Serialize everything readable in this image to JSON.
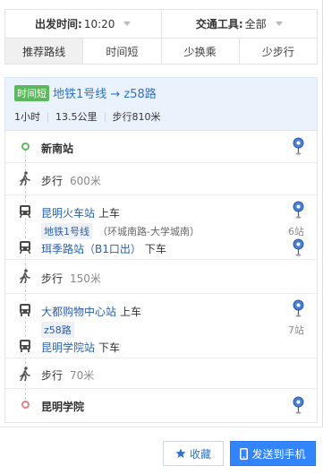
{
  "filters": {
    "depart_label": "出发时间:",
    "depart_value": "10:20",
    "transport_label": "交通工具:",
    "transport_value": "全部"
  },
  "tabs": [
    {
      "label": "推荐路线",
      "active": true
    },
    {
      "label": "时间短",
      "active": false
    },
    {
      "label": "少换乘",
      "active": false
    },
    {
      "label": "少步行",
      "active": false
    }
  ],
  "summary": {
    "tag": "时间短",
    "route": "地铁1号线 → z58路",
    "duration": "1小时",
    "distance": "13.5公里",
    "walk": "步行810米"
  },
  "steps": {
    "origin": "新南站",
    "walk1": {
      "label": "步行",
      "distance": "600米"
    },
    "ride1": {
      "board_station": "昆明火车站",
      "board_action": "上车",
      "line": "地铁1号线",
      "direction": "（环城南路-大学城南）",
      "stops": "6站",
      "alight_station": "珥季路站（B1口出）",
      "alight_action": "下车"
    },
    "walk2": {
      "label": "步行",
      "distance": "150米"
    },
    "ride2": {
      "board_station": "大都购物中心站",
      "board_action": "上车",
      "line": "z58路",
      "stops": "7站",
      "alight_station": "昆明学院站",
      "alight_action": "下车"
    },
    "walk3": {
      "label": "步行",
      "distance": "70米"
    },
    "destination": "昆明学院"
  },
  "buttons": {
    "favorite": "收藏",
    "send_to_phone": "发送到手机"
  },
  "colors": {
    "accent": "#3385ff",
    "link": "#2b5fa8",
    "origin_green": "#5cb85c",
    "destination_red": "#e38080",
    "tag_green": "#5cb85c"
  }
}
